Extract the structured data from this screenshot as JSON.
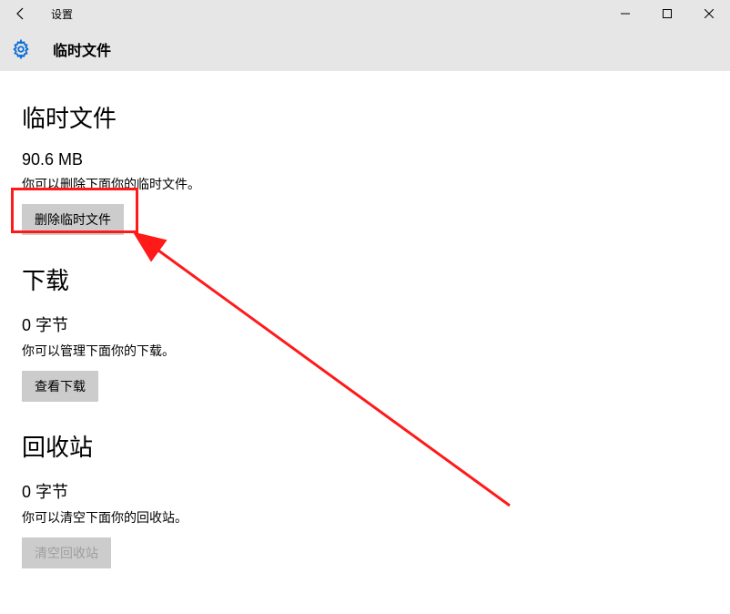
{
  "window": {
    "title": "设置"
  },
  "header": {
    "page_title": "临时文件"
  },
  "sections": {
    "temp": {
      "heading": "临时文件",
      "size": "90.6 MB",
      "desc": "你可以删除下面你的临时文件。",
      "button": "删除临时文件"
    },
    "downloads": {
      "heading": "下载",
      "size": "0 字节",
      "desc": "你可以管理下面你的下载。",
      "button": "查看下载"
    },
    "recycle": {
      "heading": "回收站",
      "size": "0 字节",
      "desc": "你可以清空下面你的回收站。",
      "button": "清空回收站"
    }
  }
}
